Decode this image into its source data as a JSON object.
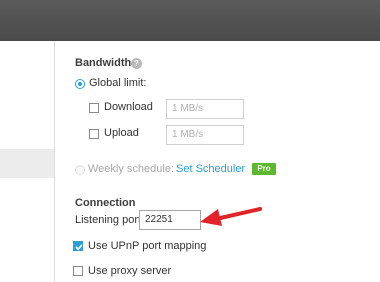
{
  "bandwidth": {
    "heading": "Bandwidth",
    "help_icon": "?",
    "global_limit_label": "Global limit:",
    "download_label": "Download",
    "download_placeholder": "1 MB/s",
    "upload_label": "Upload",
    "upload_placeholder": "1 MB/s",
    "weekly_schedule_label": "Weekly schedule:",
    "set_scheduler_link": "Set Scheduler",
    "pro_badge": "Pro"
  },
  "connection": {
    "heading": "Connection",
    "listening_port_label": "Listening port:",
    "listening_port_value": "22251",
    "upnp_label": "Use UPnP port mapping",
    "upnp_checked": true,
    "proxy_label": "Use proxy server",
    "proxy_checked": false
  },
  "colors": {
    "accent": "#2a9fd8",
    "pro_green": "#5ab92c",
    "arrow_red": "#e0242a",
    "topbar": "#4f4f4f"
  },
  "icons": [
    "help-icon",
    "red-arrow-annotation",
    "checkmark-icon"
  ]
}
